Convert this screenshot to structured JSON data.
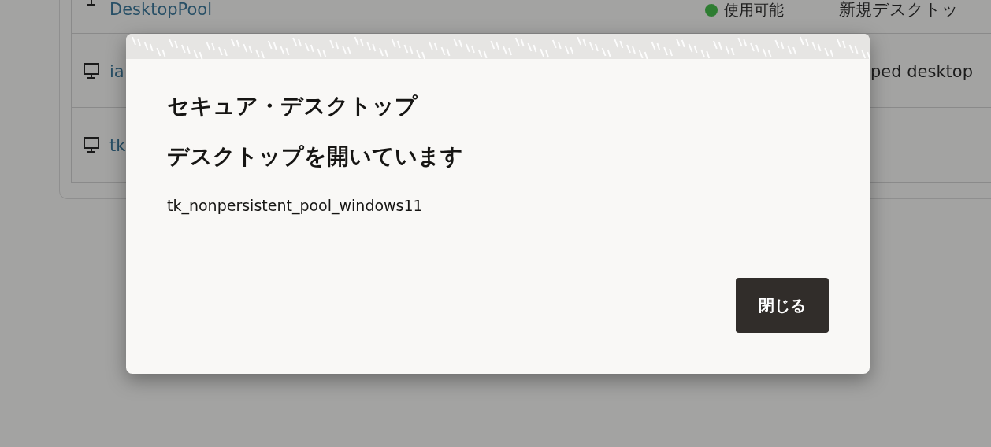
{
  "pools": [
    {
      "name": "DesktopPool",
      "status": {
        "label": "使用可能",
        "color": "#2e7d32"
      },
      "type": "新規デスクトッ"
    },
    {
      "name": "ia",
      "type": "ped desktop"
    },
    {
      "name": "tk"
    }
  ],
  "dialog": {
    "title": "セキュア・デスクトップ",
    "subtitle": "デスクトップを開いています",
    "pool_name": "tk_nonpersistent_pool_windows11",
    "buttons": [
      "閉じる"
    ]
  }
}
